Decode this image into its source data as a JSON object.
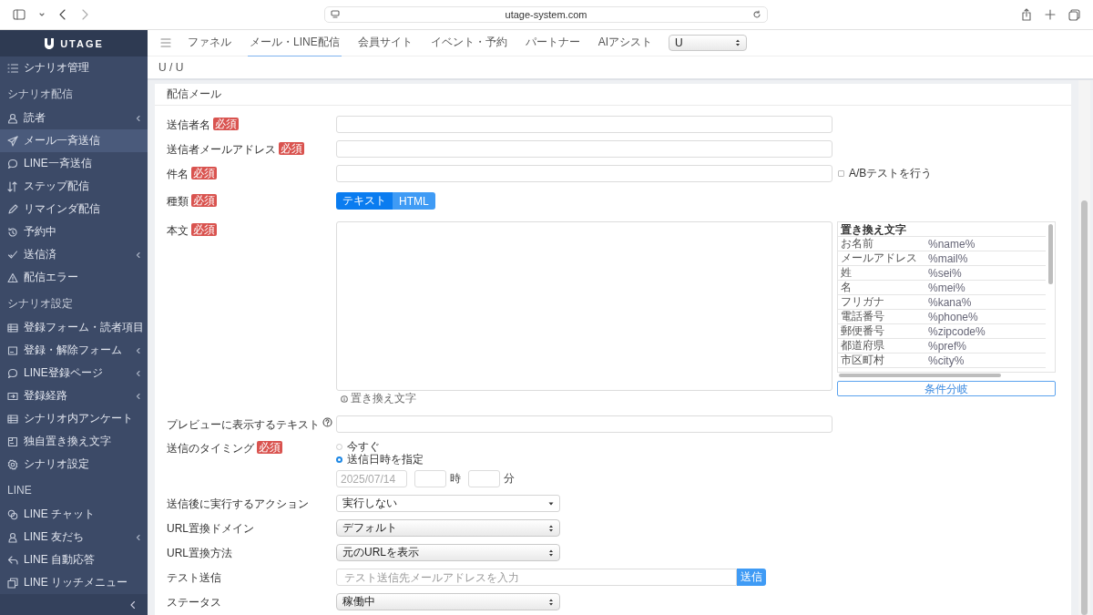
{
  "browser": {
    "url": "utage-system.com"
  },
  "sidebar": {
    "logo": "UTAGE",
    "top_item": {
      "label": "シナリオ管理",
      "selected": false
    },
    "sections": [
      {
        "title": "シナリオ配信",
        "items": [
          {
            "label": "読者",
            "selected": false,
            "has_submenu": true
          },
          {
            "label": "メール一斉送信",
            "selected": true,
            "has_submenu": false
          },
          {
            "label": "LINE一斉送信",
            "selected": false,
            "has_submenu": false
          },
          {
            "label": "ステップ配信",
            "selected": false,
            "has_submenu": false
          },
          {
            "label": "リマインダ配信",
            "selected": false,
            "has_submenu": false
          },
          {
            "label": "予約中",
            "selected": false,
            "has_submenu": false
          },
          {
            "label": "送信済",
            "selected": false,
            "has_submenu": true
          },
          {
            "label": "配信エラー",
            "selected": false,
            "has_submenu": false
          }
        ]
      },
      {
        "title": "シナリオ設定",
        "items": [
          {
            "label": "登録フォーム・読者項目",
            "selected": false,
            "has_submenu": false
          },
          {
            "label": "登録・解除フォーム",
            "selected": false,
            "has_submenu": true
          },
          {
            "label": "LINE登録ページ",
            "selected": false,
            "has_submenu": true
          },
          {
            "label": "登録経路",
            "selected": false,
            "has_submenu": true
          },
          {
            "label": "シナリオ内アンケート",
            "selected": false,
            "has_submenu": false
          },
          {
            "label": "独自置き換え文字",
            "selected": false,
            "has_submenu": false
          },
          {
            "label": "シナリオ設定",
            "selected": false,
            "has_submenu": false
          }
        ]
      },
      {
        "title": "LINE",
        "items": [
          {
            "label": "LINE チャット",
            "selected": false,
            "has_submenu": false
          },
          {
            "label": "LINE 友だち",
            "selected": false,
            "has_submenu": true
          },
          {
            "label": "LINE 自動応答",
            "selected": false,
            "has_submenu": false
          },
          {
            "label": "LINE リッチメニュー",
            "selected": false,
            "has_submenu": false
          }
        ]
      }
    ]
  },
  "nav": {
    "tabs": [
      {
        "label": "ファネル",
        "selected": false
      },
      {
        "label": "メール・LINE配信",
        "selected": true
      },
      {
        "label": "会員サイト",
        "selected": false
      },
      {
        "label": "イベント・予約",
        "selected": false
      },
      {
        "label": "パートナー",
        "selected": false
      },
      {
        "label": "AIアシスト",
        "selected": false
      }
    ],
    "select": {
      "value": "U"
    }
  },
  "breadcrumb": "U / U",
  "card": {
    "title": "配信メール",
    "rows": [
      {
        "kind": "text",
        "label": "送信者名",
        "badge": "必須"
      },
      {
        "kind": "text",
        "label": "送信者メールアドレス",
        "badge": "必須"
      },
      {
        "kind": "text",
        "label": "件名",
        "badge": "必須",
        "checkbox": {
          "label": "A/Bテストを行う",
          "checked": false
        }
      },
      {
        "kind": "toggle",
        "label": "種類",
        "badge": "必須",
        "options": [
          {
            "label": "テキスト",
            "selected": true
          },
          {
            "label": "HTML",
            "selected": false
          }
        ]
      },
      {
        "kind": "editor",
        "label": "本文",
        "badge": "必須",
        "hint": "置き換え文字",
        "table": {
          "title": "置き換え文字",
          "rows": [
            {
              "name": "お名前",
              "code": "%name%"
            },
            {
              "name": "メールアドレス",
              "code": "%mail%"
            },
            {
              "name": "姓",
              "code": "%sei%"
            },
            {
              "name": "名",
              "code": "%mei%"
            },
            {
              "name": "フリガナ",
              "code": "%kana%"
            },
            {
              "name": "電話番号",
              "code": "%phone%"
            },
            {
              "name": "郵便番号",
              "code": "%zipcode%"
            },
            {
              "name": "都道府県",
              "code": "%pref%"
            },
            {
              "name": "市区町村",
              "code": "%city%"
            }
          ]
        },
        "button": "条件分岐"
      },
      {
        "kind": "text",
        "label": "プレビューに表示するテキスト",
        "help": true
      },
      {
        "kind": "radio",
        "label": "送信のタイミング",
        "badge": "必須",
        "options": [
          {
            "label": "今すぐ",
            "selected": false
          },
          {
            "label": "送信日時を指定",
            "selected": true
          }
        ],
        "date": {
          "placeholder": "2025/07/14"
        },
        "hour_unit": "時",
        "minute_unit": "分"
      },
      {
        "kind": "dropdown",
        "label": "送信後に実行するアクション",
        "value": "実行しない"
      },
      {
        "kind": "select",
        "label": "URL置換ドメイン",
        "value": "デフォルト"
      },
      {
        "kind": "select",
        "label": "URL置換方法",
        "value": "元のURLを表示"
      },
      {
        "kind": "input_button",
        "label": "テスト送信",
        "placeholder": "テスト送信先メールアドレスを入力",
        "button": "送信"
      },
      {
        "kind": "select",
        "label": "ステータス",
        "value": "稼働中"
      }
    ]
  }
}
